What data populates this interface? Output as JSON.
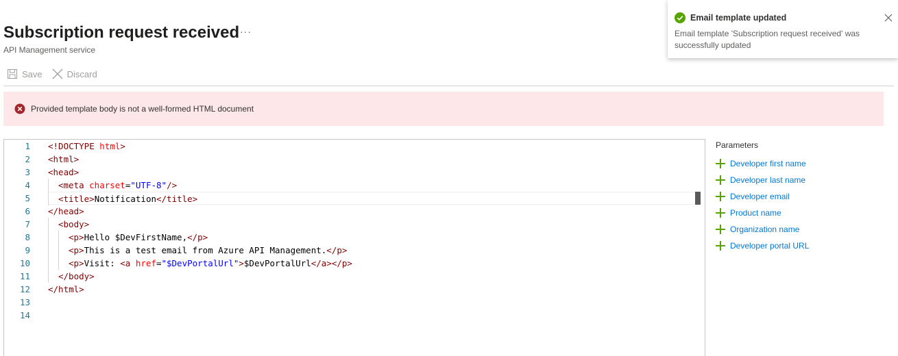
{
  "page": {
    "title": "Subscription request received",
    "more": "···",
    "subtitle": "API Management service"
  },
  "toolbar": {
    "save_label": "Save",
    "discard_label": "Discard"
  },
  "error": {
    "message": "Provided template body is not a well-formed HTML document",
    "color": "#a4262c"
  },
  "editor": {
    "line_numbers": [
      "1",
      "2",
      "3",
      "4",
      "5",
      "6",
      "7",
      "8",
      "9",
      "10",
      "11",
      "12",
      "13",
      "14"
    ],
    "lines": [
      {
        "indent": 0,
        "tokens": [
          [
            "tag",
            "<!DOCTYPE "
          ],
          [
            "attr",
            "html"
          ],
          [
            "tag",
            ">"
          ]
        ]
      },
      {
        "indent": 0,
        "tokens": [
          [
            "tag",
            "<html>"
          ]
        ]
      },
      {
        "indent": 0,
        "tokens": [
          [
            "tag",
            "<head>"
          ]
        ]
      },
      {
        "indent": 1,
        "tokens": [
          [
            "tag",
            "<meta "
          ],
          [
            "attr",
            "charset"
          ],
          [
            "txt",
            "="
          ],
          [
            "str",
            "\"UTF-8\""
          ],
          [
            "tag",
            "/>"
          ]
        ]
      },
      {
        "indent": 1,
        "current": true,
        "tokens": [
          [
            "tag",
            "<title>"
          ],
          [
            "txt",
            "Notification"
          ],
          [
            "tag",
            "</title>"
          ]
        ]
      },
      {
        "indent": 0,
        "tokens": [
          [
            "tag",
            "</head>"
          ]
        ]
      },
      {
        "indent": 1,
        "tokens": [
          [
            "tag",
            "<body>"
          ]
        ]
      },
      {
        "indent": 2,
        "tokens": [
          [
            "tag",
            "<p>"
          ],
          [
            "txt",
            "Hello $DevFirstName,"
          ],
          [
            "tag",
            "</p>"
          ]
        ]
      },
      {
        "indent": 2,
        "tokens": [
          [
            "tag",
            "<p>"
          ],
          [
            "txt",
            "This is a test email from Azure API Management."
          ],
          [
            "tag",
            "</p>"
          ]
        ]
      },
      {
        "indent": 2,
        "tokens": [
          [
            "tag",
            "<p>"
          ],
          [
            "txt",
            "Visit: "
          ],
          [
            "tag",
            "<a "
          ],
          [
            "attr",
            "href"
          ],
          [
            "txt",
            "="
          ],
          [
            "str",
            "\"$DevPortalUrl\""
          ],
          [
            "tag",
            ">"
          ],
          [
            "txt",
            "$DevPortalUrl"
          ],
          [
            "tag",
            "</a></p>"
          ]
        ]
      },
      {
        "indent": 1,
        "tokens": [
          [
            "tag",
            "</body>"
          ]
        ]
      },
      {
        "indent": 0,
        "tokens": [
          [
            "tag",
            "</html>"
          ]
        ]
      },
      {
        "indent": 0,
        "tokens": []
      },
      {
        "indent": 0,
        "tokens": []
      }
    ]
  },
  "parameters": {
    "title": "Parameters",
    "items": [
      "Developer first name",
      "Developer last name",
      "Developer email",
      "Product name",
      "Organization name",
      "Developer portal URL"
    ]
  },
  "toast": {
    "title": "Email template updated",
    "message": "Email template 'Subscription request received' was successfully updated",
    "success_color": "#57a300"
  }
}
